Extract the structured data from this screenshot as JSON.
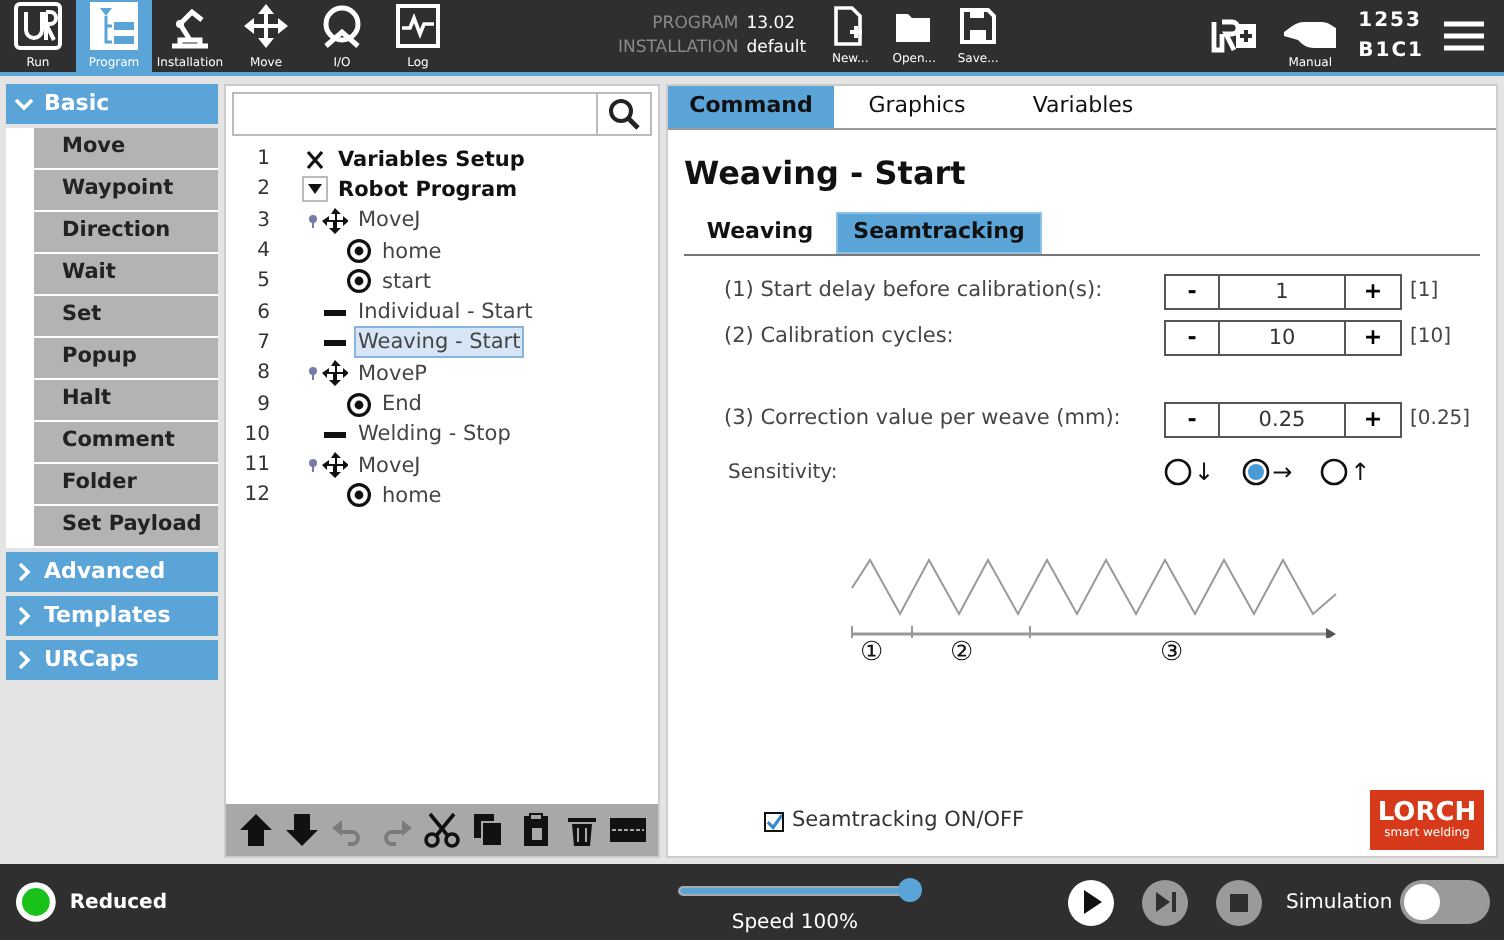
{
  "header": {
    "nav": [
      {
        "kind": "logo",
        "label": "Run",
        "selected": false
      },
      {
        "kind": "program",
        "label": "Program",
        "selected": true
      },
      {
        "kind": "installation",
        "label": "Installation",
        "selected": false
      },
      {
        "kind": "move",
        "label": "Move",
        "selected": false
      },
      {
        "kind": "io",
        "label": "I/O",
        "selected": false
      },
      {
        "kind": "log",
        "label": "Log",
        "selected": false
      }
    ],
    "program_label": "PROGRAM",
    "program_value": "13.02",
    "installation_label": "INSTALLATION",
    "installation_value": "default",
    "file_buttons": [
      {
        "kind": "new",
        "label": "New..."
      },
      {
        "kind": "open",
        "label": "Open..."
      },
      {
        "kind": "save",
        "label": "Save..."
      }
    ],
    "mode": "Manual",
    "serial_1": "1253",
    "serial_2": "B1C1"
  },
  "sidebar": {
    "groups": [
      {
        "label": "Basic",
        "expanded": true,
        "items": [
          "Move",
          "Waypoint",
          "Direction",
          "Wait",
          "Set",
          "Popup",
          "Halt",
          "Comment",
          "Folder",
          "Set Payload"
        ]
      },
      {
        "label": "Advanced",
        "expanded": false
      },
      {
        "label": "Templates",
        "expanded": false
      },
      {
        "label": "URCaps",
        "expanded": false
      }
    ]
  },
  "tree": {
    "rows": [
      {
        "number": "1",
        "kind": "variables",
        "label": "Variables Setup",
        "selected": false
      },
      {
        "number": "2",
        "kind": "program",
        "label": "Robot Program",
        "selected": false,
        "children": [
          {
            "number": "3",
            "kind": "move",
            "label": "MoveJ",
            "selected": false,
            "children": [
              {
                "number": "4",
                "kind": "waypoint",
                "label": "home",
                "selected": false
              },
              {
                "number": "5",
                "kind": "waypoint",
                "label": "start",
                "selected": false
              }
            ]
          },
          {
            "number": "6",
            "kind": "command",
            "label": "Individual - Start",
            "selected": false
          },
          {
            "number": "7",
            "kind": "command",
            "label": "Weaving - Start",
            "selected": true
          },
          {
            "number": "8",
            "kind": "move",
            "label": "MoveP",
            "selected": false,
            "children": [
              {
                "number": "9",
                "kind": "waypoint",
                "label": "End",
                "selected": false
              }
            ]
          },
          {
            "number": "10",
            "kind": "command",
            "label": "Welding - Stop",
            "selected": false
          },
          {
            "number": "11",
            "kind": "move",
            "label": "MoveJ",
            "selected": false,
            "children": [
              {
                "number": "12",
                "kind": "waypoint",
                "label": "home",
                "selected": false
              }
            ]
          }
        ]
      }
    ],
    "toolbar": [
      {
        "kind": "up",
        "disabled": false
      },
      {
        "kind": "down",
        "disabled": false
      },
      {
        "kind": "undo",
        "disabled": true
      },
      {
        "kind": "redo",
        "disabled": true
      },
      {
        "kind": "cut",
        "disabled": false
      },
      {
        "kind": "copy",
        "disabled": false
      },
      {
        "kind": "paste",
        "disabled": false
      },
      {
        "kind": "delete",
        "disabled": false
      },
      {
        "kind": "suppress",
        "disabled": false
      }
    ]
  },
  "panel": {
    "tabs": [
      {
        "label": "Command",
        "selected": true
      },
      {
        "label": "Graphics",
        "selected": false
      },
      {
        "label": "Variables",
        "selected": false
      }
    ],
    "title": "Weaving - Start",
    "subtabs": [
      {
        "label": "Weaving",
        "selected": false
      },
      {
        "label": "Seamtracking",
        "selected": true
      }
    ],
    "settings": [
      {
        "label": "(1) Start delay before calibration(s):",
        "value": "1",
        "default": "[1]",
        "minus": "-",
        "plus": "+"
      },
      {
        "label": "(2) Calibration cycles:",
        "value": "10",
        "default": "[10]",
        "minus": "-",
        "plus": "+"
      },
      {
        "label": "(3) Correction value per weave (mm):",
        "value": "0.25",
        "default": "[0.25]",
        "minus": "-",
        "plus": "+"
      }
    ],
    "sensitivity": {
      "label": "Sensitivity:",
      "options": [
        {
          "arrow": "↓",
          "selected": false
        },
        {
          "arrow": "→",
          "selected": true
        },
        {
          "arrow": "↑",
          "selected": false
        }
      ]
    },
    "diagram_markers": [
      "①",
      "②",
      "③"
    ],
    "seamtracking": {
      "label": "Seamtracking ON/OFF",
      "checked": true
    },
    "brand": {
      "name": "LORCH",
      "tagline": "smart welding"
    }
  },
  "footer": {
    "status": "Reduced",
    "speed": {
      "level": 1,
      "label": "Speed 100%"
    },
    "simulation": {
      "label": "Simulation",
      "on": false
    }
  }
}
